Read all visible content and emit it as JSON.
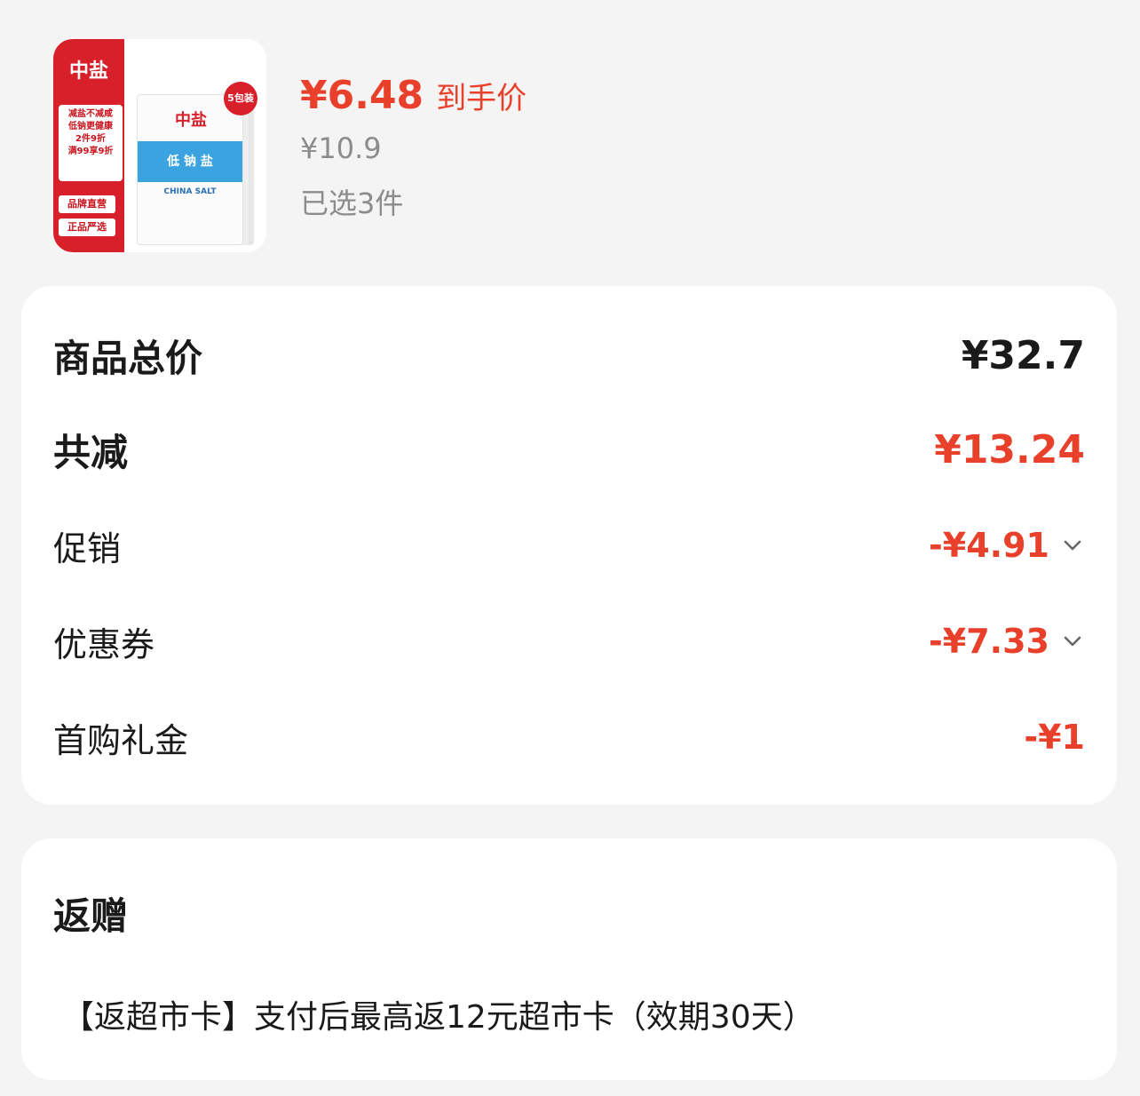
{
  "product": {
    "image": {
      "brand_logo": "中盐",
      "promo_lines": [
        "减盐不减咸",
        "低钠更健康",
        "2件9折",
        "满99享9折"
      ],
      "tags": [
        "品牌直营",
        "正品严选"
      ],
      "bag_brand": "中盐",
      "bag_product": "低 钠 盐",
      "bag_subtitle": "CHINA SALT",
      "pack_badge": "5包装"
    },
    "final_price": "¥6.48",
    "final_price_label": "到手价",
    "original_price": "¥10.9",
    "selected_count": "已选3件"
  },
  "summary": {
    "total_label": "商品总价",
    "total_value": "¥32.7",
    "discount_label": "共减",
    "discount_value": "¥13.24",
    "promo_label": "促销",
    "promo_value": "-¥4.91",
    "coupon_label": "优惠券",
    "coupon_value": "-¥7.33",
    "first_gift_label": "首购礼金",
    "first_gift_value": "-¥1"
  },
  "gift": {
    "title": "返赠",
    "description": "【返超市卡】支付后最高返12元超市卡（效期30天）"
  },
  "colors": {
    "accent_red": "#e8402a",
    "brand_red": "#d8202b",
    "muted_gray": "#8c8c8c"
  },
  "icons": {
    "promo_chevron": "chevron-down-icon",
    "coupon_chevron": "chevron-down-icon"
  }
}
